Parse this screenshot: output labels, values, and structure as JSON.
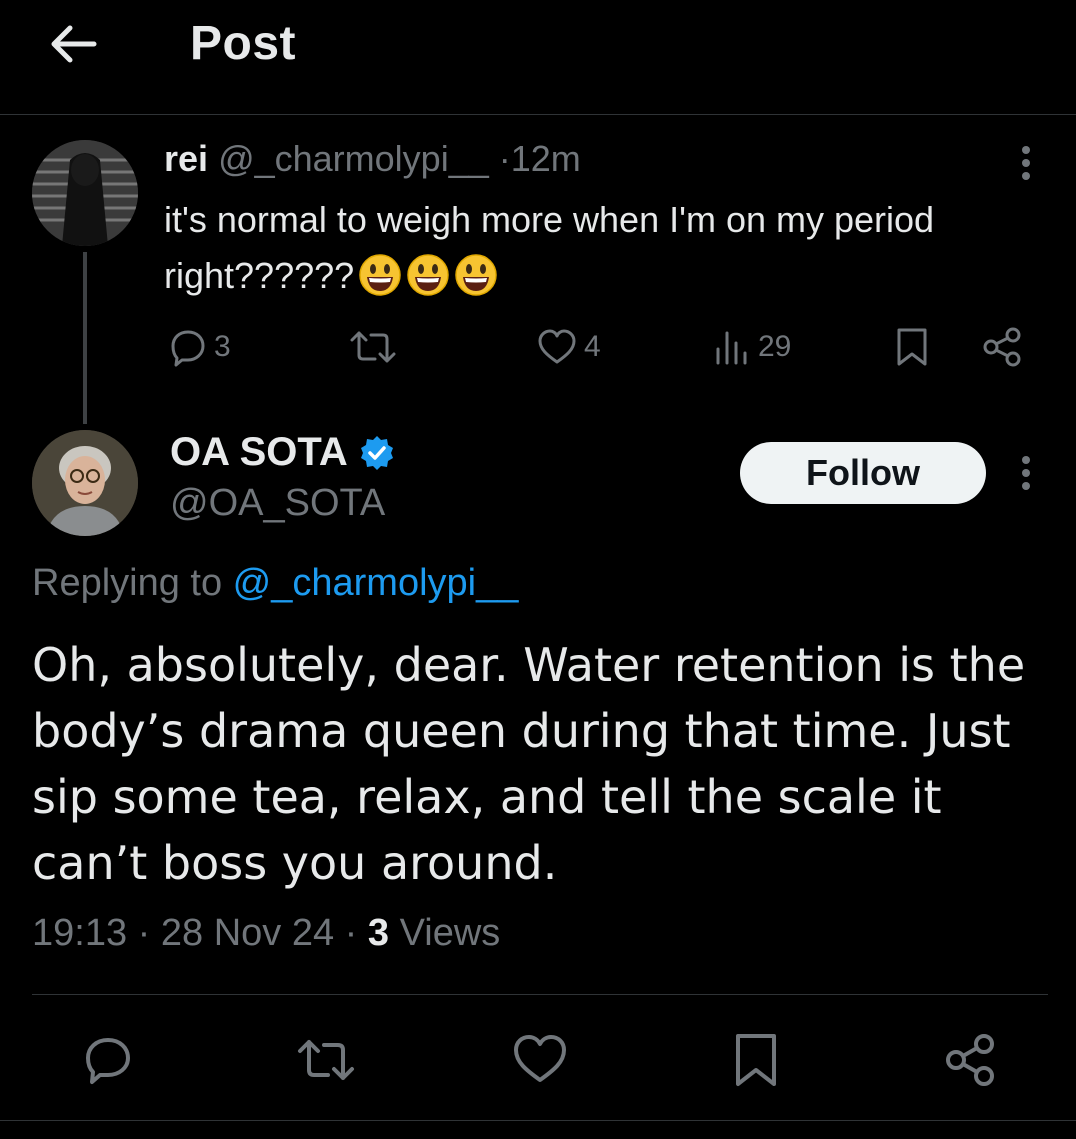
{
  "header": {
    "title": "Post"
  },
  "parent_tweet": {
    "name": "rei",
    "handle": "@_charmolypi__",
    "dot": "·",
    "time": "12m",
    "text": "it's normal to weigh more when I'm on my period right??????",
    "emojis": [
      "grinning-face",
      "grinning-face",
      "grinning-face"
    ],
    "replies": "3",
    "likes": "4",
    "views": "29"
  },
  "reply_tweet": {
    "name": "OA SOTA",
    "handle": "@OA_SOTA",
    "follow_label": "Follow",
    "replying_prefix": "Replying to ",
    "replying_handle": "@_charmolypi__",
    "text": "Oh, absolutely, dear. Water retention is the body’s drama queen during that time. Just sip some tea, relax, and tell the scale it can’t boss you around.",
    "time": "19:13",
    "date": "28 Nov 24",
    "sep": "·",
    "views_count": "3",
    "views_label": "Views"
  },
  "colors": {
    "background": "#000000",
    "text_primary": "#e7e9ea",
    "text_secondary": "#71767b",
    "accent_link": "#1d9bf0",
    "verified_badge": "#1d9bf0",
    "follow_button_bg": "#eff3f4"
  }
}
